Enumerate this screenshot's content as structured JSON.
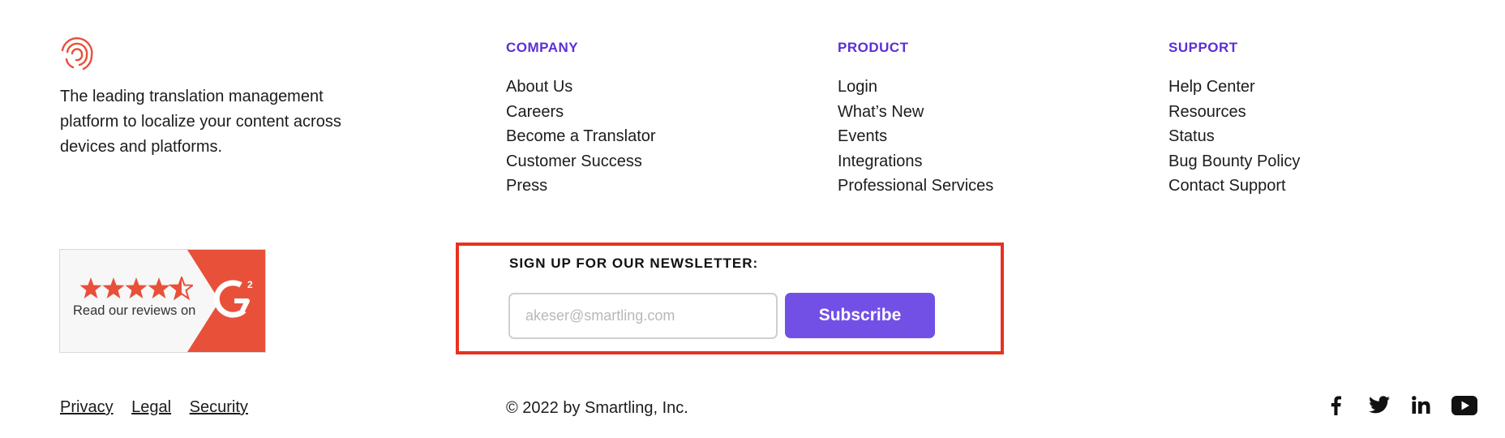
{
  "brand": {
    "tagline": "The leading translation management platform to localize your content across devices and platforms.",
    "logo_icon": "fingerprint-logo-icon",
    "accent_color": "#e8503a"
  },
  "columns": [
    {
      "heading": "COMPANY",
      "links": [
        "About Us",
        "Careers",
        "Become a Translator",
        "Customer Success",
        "Press"
      ]
    },
    {
      "heading": "PRODUCT",
      "links": [
        "Login",
        "What’s New",
        "Events",
        "Integrations",
        "Professional Services"
      ]
    },
    {
      "heading": "SUPPORT",
      "links": [
        "Help Center",
        "Resources",
        "Status",
        "Bug Bounty Policy",
        "Contact Support"
      ]
    }
  ],
  "g2_badge": {
    "text": "Read our reviews on",
    "rating": 4.5,
    "logo_text": "G2",
    "stars_icon": "star-icon"
  },
  "newsletter": {
    "title": "SIGN UP FOR OUR NEWSLETTER:",
    "placeholder": "akeser@smartling.com",
    "button_label": "Subscribe",
    "button_color": "#7250e6",
    "highlight_color": "#e8311f"
  },
  "legal_links": [
    "Privacy",
    "Legal",
    "Security"
  ],
  "copyright": "© 2022 by Smartling, Inc.",
  "social": [
    "facebook-icon",
    "twitter-icon",
    "linkedin-icon",
    "youtube-icon"
  ],
  "heading_color": "#5b2fd6"
}
